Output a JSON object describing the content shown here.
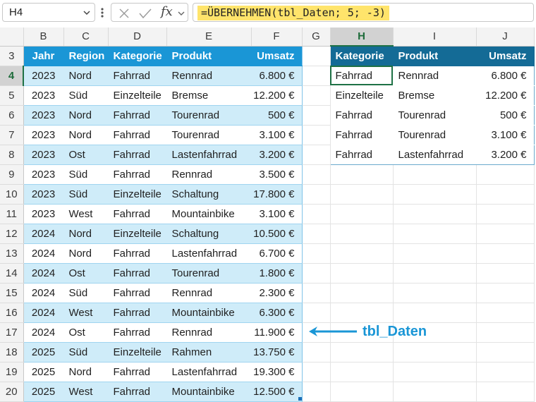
{
  "formula_bar": {
    "name_box": "H4",
    "fx_label": "fx",
    "formula": "=ÜBERNEHMEN(tbl_Daten; 5; -3)"
  },
  "columns": [
    "B",
    "C",
    "D",
    "E",
    "F",
    "G",
    "H",
    "I",
    "J"
  ],
  "row_numbers": [
    "3",
    "4",
    "5",
    "6",
    "7",
    "8",
    "9",
    "10",
    "11",
    "12",
    "13",
    "14",
    "15",
    "16",
    "17",
    "18",
    "19",
    "20"
  ],
  "tbl_daten": {
    "headers": [
      "Jahr",
      "Region",
      "Kategorie",
      "Produkt",
      "Umsatz"
    ],
    "rows": [
      [
        "2023",
        "Nord",
        "Fahrrad",
        "Rennrad",
        "6.800 €"
      ],
      [
        "2023",
        "Süd",
        "Einzelteile",
        "Bremse",
        "12.200 €"
      ],
      [
        "2023",
        "Nord",
        "Fahrrad",
        "Tourenrad",
        "500 €"
      ],
      [
        "2023",
        "Nord",
        "Fahrrad",
        "Tourenrad",
        "3.100 €"
      ],
      [
        "2023",
        "Ost",
        "Fahrrad",
        "Lastenfahrrad",
        "3.200 €"
      ],
      [
        "2023",
        "Süd",
        "Fahrrad",
        "Rennrad",
        "3.500 €"
      ],
      [
        "2023",
        "Süd",
        "Einzelteile",
        "Schaltung",
        "17.800 €"
      ],
      [
        "2023",
        "West",
        "Fahrrad",
        "Mountainbike",
        "3.100 €"
      ],
      [
        "2024",
        "Nord",
        "Einzelteile",
        "Schaltung",
        "10.500 €"
      ],
      [
        "2024",
        "Nord",
        "Fahrrad",
        "Lastenfahrrad",
        "6.700 €"
      ],
      [
        "2024",
        "Ost",
        "Fahrrad",
        "Tourenrad",
        "1.800 €"
      ],
      [
        "2024",
        "Süd",
        "Fahrrad",
        "Rennrad",
        "2.300 €"
      ],
      [
        "2024",
        "West",
        "Fahrrad",
        "Mountainbike",
        "6.300 €"
      ],
      [
        "2024",
        "Ost",
        "Fahrrad",
        "Rennrad",
        "11.900 €"
      ],
      [
        "2025",
        "Süd",
        "Einzelteile",
        "Rahmen",
        "13.750 €"
      ],
      [
        "2025",
        "Nord",
        "Fahrrad",
        "Lastenfahrrad",
        "19.300 €"
      ],
      [
        "2025",
        "West",
        "Fahrrad",
        "Mountainbike",
        "12.500 €"
      ]
    ]
  },
  "result": {
    "headers": [
      "Kategorie",
      "Produkt",
      "Umsatz"
    ],
    "rows": [
      [
        "Fahrrad",
        "Rennrad",
        "6.800 €"
      ],
      [
        "Einzelteile",
        "Bremse",
        "12.200 €"
      ],
      [
        "Fahrrad",
        "Tourenrad",
        "500 €"
      ],
      [
        "Fahrrad",
        "Tourenrad",
        "3.100 €"
      ],
      [
        "Fahrrad",
        "Lastenfahrrad",
        "3.200 €"
      ]
    ]
  },
  "annotation": {
    "label": "tbl_Daten"
  },
  "colors": {
    "table_header": "#1a96d6",
    "band": "#cfecf9",
    "result_header": "#146b96",
    "formula_highlight": "#ffe46b",
    "selection": "#1e7145"
  }
}
